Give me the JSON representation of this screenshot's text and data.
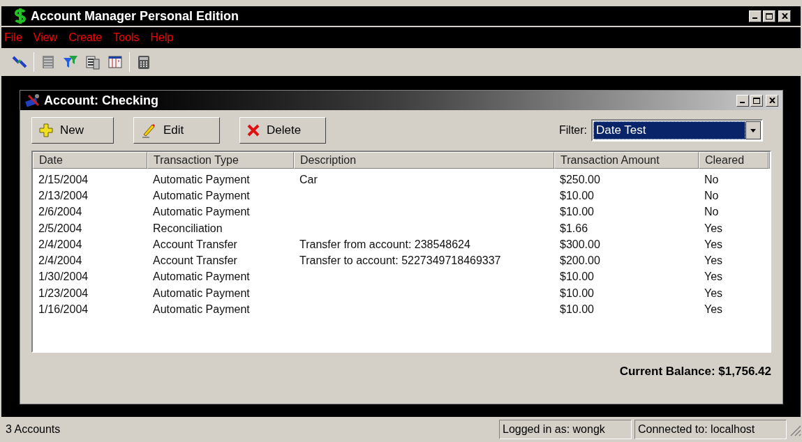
{
  "window": {
    "title": "Account Manager Personal Edition"
  },
  "menu": [
    "File",
    "View",
    "Create",
    "Tools",
    "Help"
  ],
  "child_window": {
    "title": "Account: Checking",
    "buttons": [
      {
        "label": "New",
        "kind": "new"
      },
      {
        "label": "Edit",
        "kind": "edit"
      },
      {
        "label": "Delete",
        "kind": "delete"
      }
    ],
    "filter": {
      "label": "Filter:",
      "value": "Date Test"
    },
    "table": {
      "columns": [
        "Date",
        "Transaction Type",
        "Description",
        "Transaction Amount",
        "Cleared"
      ],
      "rows": [
        [
          "2/15/2004",
          "Automatic Payment",
          "Car",
          "$250.00",
          "No"
        ],
        [
          "2/13/2004",
          "Automatic Payment",
          "",
          "$10.00",
          "No"
        ],
        [
          "2/6/2004",
          "Automatic Payment",
          "",
          "$10.00",
          "No"
        ],
        [
          "2/5/2004",
          "Reconciliation",
          "",
          "$1.66",
          "Yes"
        ],
        [
          "2/4/2004",
          "Account Transfer",
          "Transfer from account: 238548624",
          "$300.00",
          "Yes"
        ],
        [
          "2/4/2004",
          "Account Transfer",
          "Transfer to account: 5227349718469337",
          "$200.00",
          "Yes"
        ],
        [
          "1/30/2004",
          "Automatic Payment",
          "",
          "$10.00",
          "Yes"
        ],
        [
          "1/23/2004",
          "Automatic Payment",
          "",
          "$10.00",
          "Yes"
        ],
        [
          "1/16/2004",
          "Automatic Payment",
          "",
          "$10.00",
          "Yes"
        ]
      ]
    },
    "balance": "Current Balance: $1,756.42"
  },
  "status_bar": {
    "accounts": "3 Accounts",
    "user": "Logged in as: wongk",
    "connection": "Connected to: localhost"
  }
}
